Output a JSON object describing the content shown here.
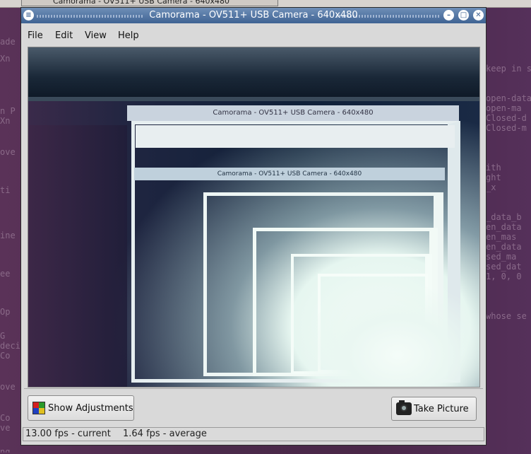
{
  "background": {
    "taskbar_item": "Camorama - OV511+ USB Camera - 640x480",
    "left_fragments": [
      "ade",
      "Xn",
      "n P",
      "Xn",
      "ove",
      "ti",
      "ine",
      "ee",
      "Op",
      "G",
      "deci",
      "Co",
      "ove",
      "Co",
      "ve",
      "ng"
    ],
    "right_fragments": [
      "keep in sy",
      "",
      "",
      "open-data",
      "open-ma",
      "Closed-d",
      "Closed-m",
      "",
      "",
      "",
      "ith",
      "ght",
      "_x",
      "",
      "",
      "_data_b",
      "en_data",
      "en_mas",
      "en_data",
      "sed_ma",
      "sed_dat",
      "1, 0, 0",
      "",
      "",
      "",
      "whose se"
    ]
  },
  "window": {
    "title": "Camorama - OV511+ USB Camera - 640x480",
    "menu": [
      {
        "label": "File"
      },
      {
        "label": "Edit"
      },
      {
        "label": "View"
      },
      {
        "label": "Help"
      }
    ],
    "feed_text": {
      "nested_title_1": "Camorama - OV511+ USB Camera - 640x480",
      "nested_title_2": "Camorama - OV511+ USB Camera - 640x480"
    },
    "buttons": {
      "show_adjustments": "Show Adjustments",
      "take_picture": "Take Picture"
    },
    "status": {
      "current": "13.00 fps - current",
      "average": "1.64 fps - average"
    }
  },
  "colors": {
    "titlebar": "#4f73a3",
    "window_bg": "#d9d9d9",
    "desktop": "#4a2a48"
  }
}
